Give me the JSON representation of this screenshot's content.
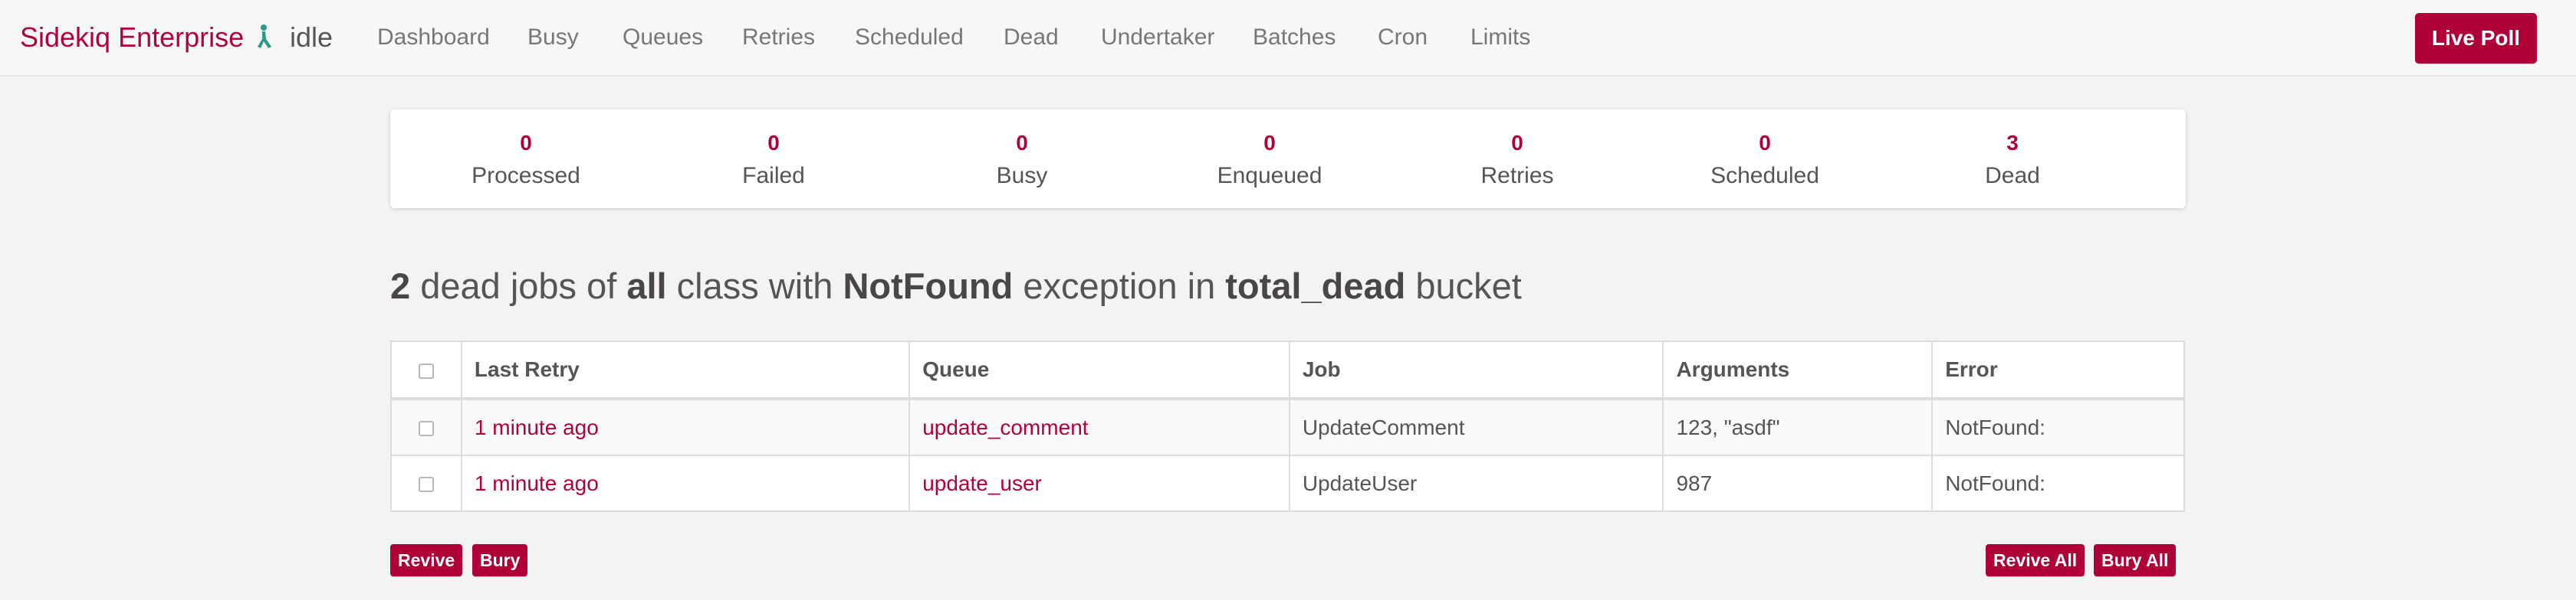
{
  "header": {
    "brand": "Sidekiq Enterprise",
    "status": "idle",
    "nav": [
      "Dashboard",
      "Busy",
      "Queues",
      "Retries",
      "Scheduled",
      "Dead",
      "Undertaker",
      "Batches",
      "Cron",
      "Limits"
    ],
    "live_poll": "Live Poll",
    "accent_color": "#b1003e"
  },
  "stats": [
    {
      "value": "0",
      "label": "Processed"
    },
    {
      "value": "0",
      "label": "Failed"
    },
    {
      "value": "0",
      "label": "Busy"
    },
    {
      "value": "0",
      "label": "Enqueued"
    },
    {
      "value": "0",
      "label": "Retries"
    },
    {
      "value": "0",
      "label": "Scheduled"
    },
    {
      "value": "3",
      "label": "Dead"
    }
  ],
  "heading": {
    "count": "2",
    "t1": " dead jobs of ",
    "klass": "all",
    "t2": " class with ",
    "exception": "NotFound",
    "t3": " exception in ",
    "bucket": "total_dead",
    "t4": " bucket"
  },
  "table": {
    "columns": [
      "Last Retry",
      "Queue",
      "Job",
      "Arguments",
      "Error"
    ],
    "rows": [
      {
        "last_retry": "1 minute ago",
        "queue": "update_comment",
        "job": "UpdateComment",
        "arguments": "123, \"asdf\"",
        "error": "NotFound:"
      },
      {
        "last_retry": "1 minute ago",
        "queue": "update_user",
        "job": "UpdateUser",
        "arguments": "987",
        "error": "NotFound:"
      }
    ]
  },
  "actions": {
    "revive": "Revive",
    "bury": "Bury",
    "revive_all": "Revive All",
    "bury_all": "Bury All"
  }
}
